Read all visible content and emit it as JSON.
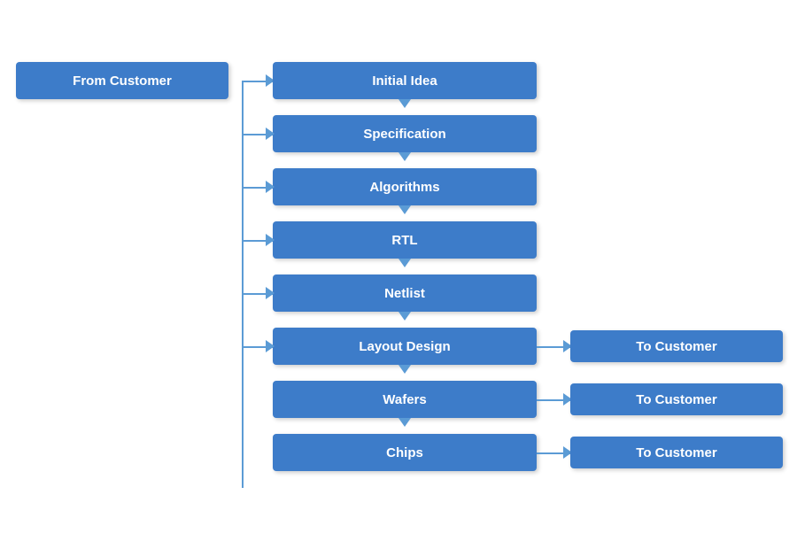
{
  "boxes": {
    "from_customer": "From Customer",
    "initial_idea": "Initial Idea",
    "specification": "Specification",
    "algorithms": "Algorithms",
    "rtl": "RTL",
    "netlist": "Netlist",
    "layout_design": "Layout Design",
    "wafers": "Wafers",
    "chips": "Chips",
    "to_customer_1": "To Customer",
    "to_customer_2": "To Customer",
    "to_customer_3": "To Customer"
  }
}
